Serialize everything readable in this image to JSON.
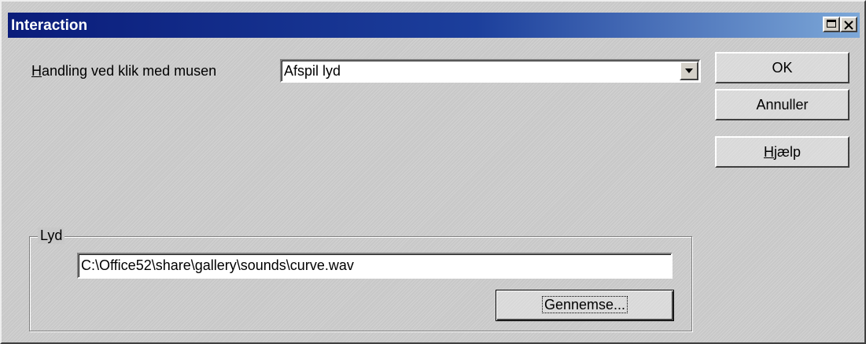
{
  "window": {
    "title": "Interaction",
    "title_bar_gradient": [
      "#0a1c7a",
      "#7da8d8"
    ]
  },
  "title_buttons": {
    "maximize_icon": "maximize-icon",
    "close_icon": "close-icon"
  },
  "action": {
    "label_accel": "H",
    "label_rest": "andling ved klik med musen",
    "selected_value": "Afspil lyd",
    "dropdown_icon": "chevron-down-icon"
  },
  "buttons": {
    "ok": "OK",
    "cancel": "Annuller",
    "help_accel": "H",
    "help_rest": "jælp"
  },
  "sound_group": {
    "label": "Lyd",
    "path_value": "C:\\Office52\\share\\gallery\\sounds\\curve.wav",
    "browse_label": "Gennemse..."
  }
}
